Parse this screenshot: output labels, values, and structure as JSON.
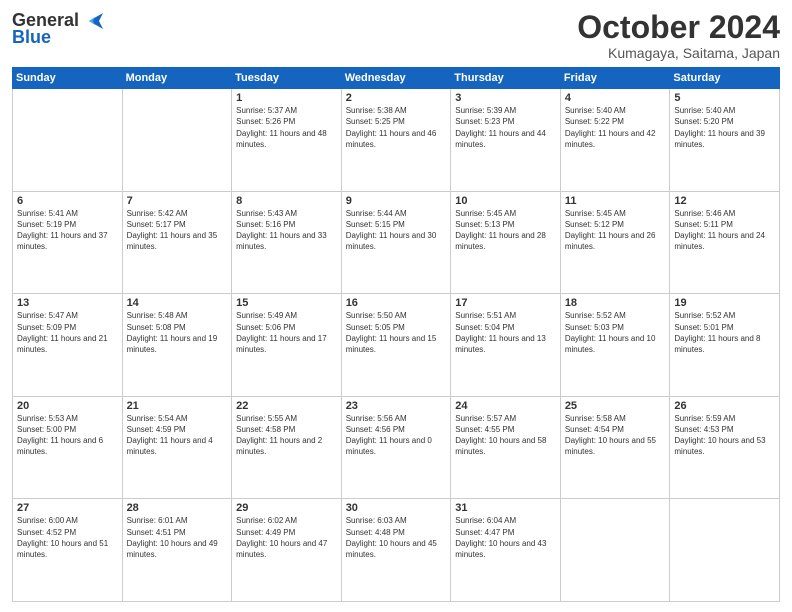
{
  "header": {
    "logo_general": "General",
    "logo_blue": "Blue",
    "title": "October 2024",
    "location": "Kumagaya, Saitama, Japan"
  },
  "weekdays": [
    "Sunday",
    "Monday",
    "Tuesday",
    "Wednesday",
    "Thursday",
    "Friday",
    "Saturday"
  ],
  "weeks": [
    [
      {
        "day": "",
        "sunrise": "",
        "sunset": "",
        "daylight": ""
      },
      {
        "day": "",
        "sunrise": "",
        "sunset": "",
        "daylight": ""
      },
      {
        "day": "1",
        "sunrise": "Sunrise: 5:37 AM",
        "sunset": "Sunset: 5:26 PM",
        "daylight": "Daylight: 11 hours and 48 minutes."
      },
      {
        "day": "2",
        "sunrise": "Sunrise: 5:38 AM",
        "sunset": "Sunset: 5:25 PM",
        "daylight": "Daylight: 11 hours and 46 minutes."
      },
      {
        "day": "3",
        "sunrise": "Sunrise: 5:39 AM",
        "sunset": "Sunset: 5:23 PM",
        "daylight": "Daylight: 11 hours and 44 minutes."
      },
      {
        "day": "4",
        "sunrise": "Sunrise: 5:40 AM",
        "sunset": "Sunset: 5:22 PM",
        "daylight": "Daylight: 11 hours and 42 minutes."
      },
      {
        "day": "5",
        "sunrise": "Sunrise: 5:40 AM",
        "sunset": "Sunset: 5:20 PM",
        "daylight": "Daylight: 11 hours and 39 minutes."
      }
    ],
    [
      {
        "day": "6",
        "sunrise": "Sunrise: 5:41 AM",
        "sunset": "Sunset: 5:19 PM",
        "daylight": "Daylight: 11 hours and 37 minutes."
      },
      {
        "day": "7",
        "sunrise": "Sunrise: 5:42 AM",
        "sunset": "Sunset: 5:17 PM",
        "daylight": "Daylight: 11 hours and 35 minutes."
      },
      {
        "day": "8",
        "sunrise": "Sunrise: 5:43 AM",
        "sunset": "Sunset: 5:16 PM",
        "daylight": "Daylight: 11 hours and 33 minutes."
      },
      {
        "day": "9",
        "sunrise": "Sunrise: 5:44 AM",
        "sunset": "Sunset: 5:15 PM",
        "daylight": "Daylight: 11 hours and 30 minutes."
      },
      {
        "day": "10",
        "sunrise": "Sunrise: 5:45 AM",
        "sunset": "Sunset: 5:13 PM",
        "daylight": "Daylight: 11 hours and 28 minutes."
      },
      {
        "day": "11",
        "sunrise": "Sunrise: 5:45 AM",
        "sunset": "Sunset: 5:12 PM",
        "daylight": "Daylight: 11 hours and 26 minutes."
      },
      {
        "day": "12",
        "sunrise": "Sunrise: 5:46 AM",
        "sunset": "Sunset: 5:11 PM",
        "daylight": "Daylight: 11 hours and 24 minutes."
      }
    ],
    [
      {
        "day": "13",
        "sunrise": "Sunrise: 5:47 AM",
        "sunset": "Sunset: 5:09 PM",
        "daylight": "Daylight: 11 hours and 21 minutes."
      },
      {
        "day": "14",
        "sunrise": "Sunrise: 5:48 AM",
        "sunset": "Sunset: 5:08 PM",
        "daylight": "Daylight: 11 hours and 19 minutes."
      },
      {
        "day": "15",
        "sunrise": "Sunrise: 5:49 AM",
        "sunset": "Sunset: 5:06 PM",
        "daylight": "Daylight: 11 hours and 17 minutes."
      },
      {
        "day": "16",
        "sunrise": "Sunrise: 5:50 AM",
        "sunset": "Sunset: 5:05 PM",
        "daylight": "Daylight: 11 hours and 15 minutes."
      },
      {
        "day": "17",
        "sunrise": "Sunrise: 5:51 AM",
        "sunset": "Sunset: 5:04 PM",
        "daylight": "Daylight: 11 hours and 13 minutes."
      },
      {
        "day": "18",
        "sunrise": "Sunrise: 5:52 AM",
        "sunset": "Sunset: 5:03 PM",
        "daylight": "Daylight: 11 hours and 10 minutes."
      },
      {
        "day": "19",
        "sunrise": "Sunrise: 5:52 AM",
        "sunset": "Sunset: 5:01 PM",
        "daylight": "Daylight: 11 hours and 8 minutes."
      }
    ],
    [
      {
        "day": "20",
        "sunrise": "Sunrise: 5:53 AM",
        "sunset": "Sunset: 5:00 PM",
        "daylight": "Daylight: 11 hours and 6 minutes."
      },
      {
        "day": "21",
        "sunrise": "Sunrise: 5:54 AM",
        "sunset": "Sunset: 4:59 PM",
        "daylight": "Daylight: 11 hours and 4 minutes."
      },
      {
        "day": "22",
        "sunrise": "Sunrise: 5:55 AM",
        "sunset": "Sunset: 4:58 PM",
        "daylight": "Daylight: 11 hours and 2 minutes."
      },
      {
        "day": "23",
        "sunrise": "Sunrise: 5:56 AM",
        "sunset": "Sunset: 4:56 PM",
        "daylight": "Daylight: 11 hours and 0 minutes."
      },
      {
        "day": "24",
        "sunrise": "Sunrise: 5:57 AM",
        "sunset": "Sunset: 4:55 PM",
        "daylight": "Daylight: 10 hours and 58 minutes."
      },
      {
        "day": "25",
        "sunrise": "Sunrise: 5:58 AM",
        "sunset": "Sunset: 4:54 PM",
        "daylight": "Daylight: 10 hours and 55 minutes."
      },
      {
        "day": "26",
        "sunrise": "Sunrise: 5:59 AM",
        "sunset": "Sunset: 4:53 PM",
        "daylight": "Daylight: 10 hours and 53 minutes."
      }
    ],
    [
      {
        "day": "27",
        "sunrise": "Sunrise: 6:00 AM",
        "sunset": "Sunset: 4:52 PM",
        "daylight": "Daylight: 10 hours and 51 minutes."
      },
      {
        "day": "28",
        "sunrise": "Sunrise: 6:01 AM",
        "sunset": "Sunset: 4:51 PM",
        "daylight": "Daylight: 10 hours and 49 minutes."
      },
      {
        "day": "29",
        "sunrise": "Sunrise: 6:02 AM",
        "sunset": "Sunset: 4:49 PM",
        "daylight": "Daylight: 10 hours and 47 minutes."
      },
      {
        "day": "30",
        "sunrise": "Sunrise: 6:03 AM",
        "sunset": "Sunset: 4:48 PM",
        "daylight": "Daylight: 10 hours and 45 minutes."
      },
      {
        "day": "31",
        "sunrise": "Sunrise: 6:04 AM",
        "sunset": "Sunset: 4:47 PM",
        "daylight": "Daylight: 10 hours and 43 minutes."
      },
      {
        "day": "",
        "sunrise": "",
        "sunset": "",
        "daylight": ""
      },
      {
        "day": "",
        "sunrise": "",
        "sunset": "",
        "daylight": ""
      }
    ]
  ]
}
